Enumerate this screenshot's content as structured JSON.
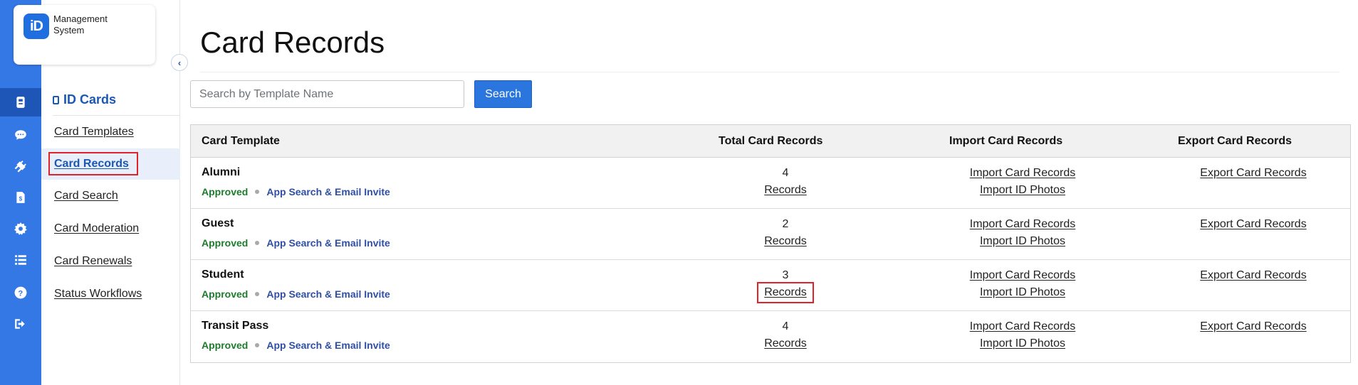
{
  "logo": {
    "mark": "iD",
    "text": "Management System"
  },
  "rail": {
    "items": [
      {
        "icon": "id-card-icon"
      },
      {
        "icon": "chat-icon"
      },
      {
        "icon": "plug-icon"
      },
      {
        "icon": "billing-icon"
      },
      {
        "icon": "gear-icon"
      },
      {
        "icon": "list-icon"
      },
      {
        "icon": "help-icon"
      },
      {
        "icon": "logout-icon"
      }
    ]
  },
  "sidebar": {
    "section_title": "ID Cards",
    "items": [
      {
        "label": "Card Templates"
      },
      {
        "label": "Card Records",
        "active": true
      },
      {
        "label": "Card Search"
      },
      {
        "label": "Card Moderation"
      },
      {
        "label": "Card Renewals"
      },
      {
        "label": "Status Workflows"
      }
    ]
  },
  "main": {
    "title": "Card Records",
    "search": {
      "placeholder": "Search by Template Name",
      "value": "",
      "button_label": "Search"
    },
    "table": {
      "headers": [
        "Card Template",
        "Total Card Records",
        "Import Card Records",
        "Export Card Records"
      ],
      "rows": [
        {
          "name": "Alumni",
          "status": "Approved",
          "access": "App Search & Email Invite",
          "count": "4",
          "records_link": "Records",
          "import_records": "Import Card Records",
          "import_photos": "Import ID Photos",
          "export": "Export Card Records"
        },
        {
          "name": "Guest",
          "status": "Approved",
          "access": "App Search & Email Invite",
          "count": "2",
          "records_link": "Records",
          "import_records": "Import Card Records",
          "import_photos": "Import ID Photos",
          "export": "Export Card Records"
        },
        {
          "name": "Student",
          "status": "Approved",
          "access": "App Search & Email Invite",
          "count": "3",
          "records_link": "Records",
          "import_records": "Import Card Records",
          "import_photos": "Import ID Photos",
          "export": "Export Card Records"
        },
        {
          "name": "Transit Pass",
          "status": "Approved",
          "access": "App Search & Email Invite",
          "count": "4",
          "records_link": "Records",
          "import_records": "Import Card Records",
          "import_photos": "Import ID Photos",
          "export": "Export Card Records"
        }
      ]
    }
  },
  "colors": {
    "rail": "#3478e6",
    "accent": "#2b75de",
    "approved": "#1c7c2c",
    "highlight": "#e0222b"
  }
}
